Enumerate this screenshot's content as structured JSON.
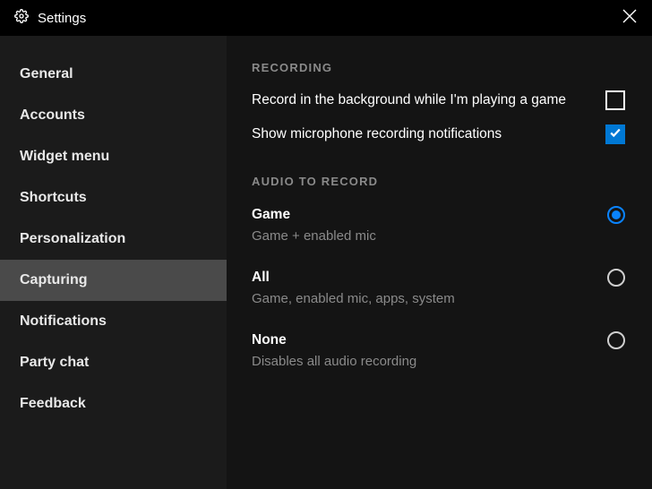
{
  "titlebar": {
    "title": "Settings"
  },
  "sidebar": {
    "items": [
      {
        "label": "General"
      },
      {
        "label": "Accounts"
      },
      {
        "label": "Widget menu"
      },
      {
        "label": "Shortcuts"
      },
      {
        "label": "Personalization"
      },
      {
        "label": "Capturing"
      },
      {
        "label": "Notifications"
      },
      {
        "label": "Party chat"
      },
      {
        "label": "Feedback"
      }
    ],
    "active_index": 5
  },
  "main": {
    "recording": {
      "header": "RECORDING",
      "background_label": "Record in the background while I'm playing a game",
      "background_checked": false,
      "mic_notify_label": "Show microphone recording notifications",
      "mic_notify_checked": true
    },
    "audio": {
      "header": "AUDIO TO RECORD",
      "selected": "game",
      "options": {
        "game": {
          "title": "Game",
          "desc": "Game + enabled mic"
        },
        "all": {
          "title": "All",
          "desc": "Game, enabled mic, apps, system"
        },
        "none": {
          "title": "None",
          "desc": "Disables all audio recording"
        }
      }
    }
  }
}
